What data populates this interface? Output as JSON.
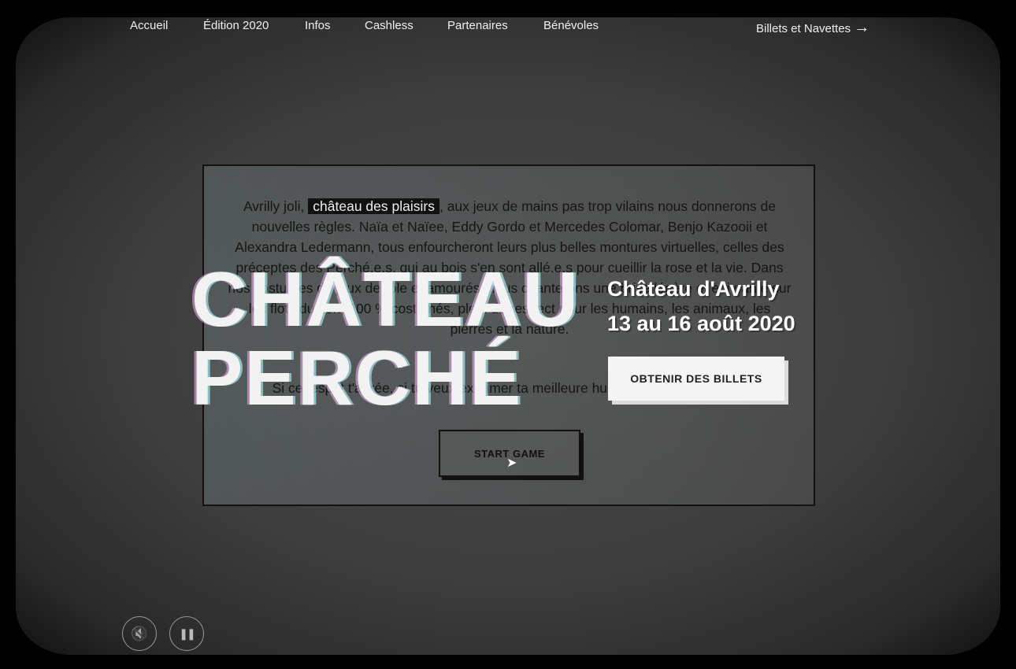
{
  "nav": {
    "items": [
      "Accueil",
      "Édition 2020",
      "Infos",
      "Cashless",
      "Partenaires",
      "Bénévoles"
    ],
    "cta": "Billets et Navettes",
    "cta_icon": "→"
  },
  "hero": {
    "title_line1": "CHÂTEAU",
    "title_line2": "PERCHÉ",
    "venue": "Château d'Avrilly",
    "dates": "13 au 16 août 2020",
    "tickets_button": "OBTENIR DES BILLETS"
  },
  "panel": {
    "intro_before": "Avrilly joli, ",
    "highlight": "château des plaisirs",
    "intro_after": ", aux jeux de mains pas trop vilains nous donnerons de nouvelles règles. Naïa et Naïee, Eddy Gordo et Mercedes Colomar, Benjo Kazooii et Alexandra Ledermann, tous enfourcheront leurs plus belles montures virtuelles, celles des préceptes des Perché.e.s, qui au bois s'en sont allé.e.s pour cueillir la rose et la vie. Dans nos costumes de jeux de rôle enamourés, nous chanterons une brise légère et enivrante sur les flots du son, 100 % costumés, plein de respect pour les humains, les animaux, les pierres et la nature.",
    "start_prompt": "Si cet esprit t'agrée, si tu veux exprimer ta meilleure humanité, presse START",
    "start_button": "START GAME"
  },
  "controls": {
    "mute_icon": "🔇",
    "pause_icon": "❚❚"
  }
}
